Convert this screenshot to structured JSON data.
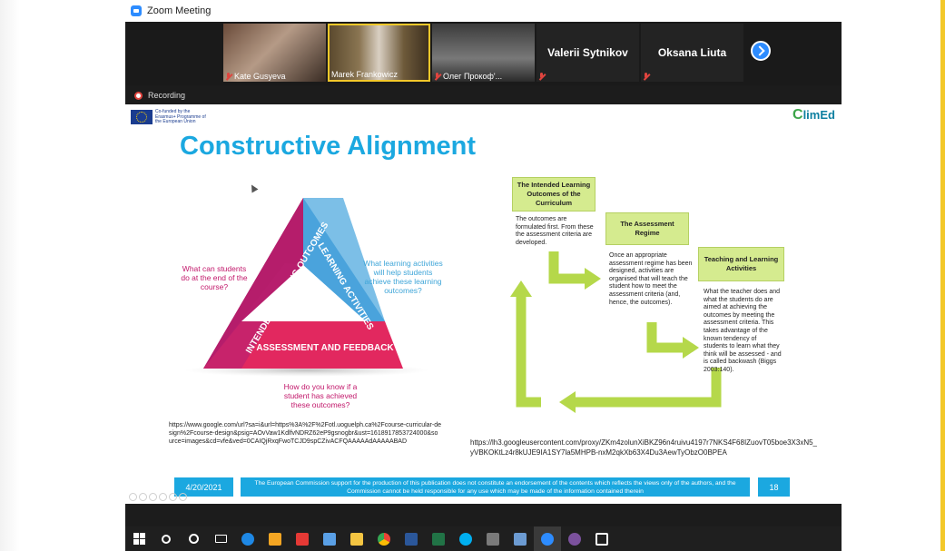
{
  "window": {
    "title": "Zoom Meeting"
  },
  "participants": [
    {
      "name": "Kate Gusyeva",
      "muted": true
    },
    {
      "name": "Marek Frankowicz",
      "muted": false
    },
    {
      "name": "Олег Прокоф'...",
      "muted": true
    },
    {
      "name": "Valerii Sytnikov",
      "muted": true
    },
    {
      "name": "Oksana Liuta",
      "muted": true
    }
  ],
  "recording_label": "Recording",
  "slide": {
    "logo_text": "Co-funded by the Erasmus+ Programme of the European Union",
    "brand": "ClimEd",
    "title": "Constructive Alignment",
    "triangle": {
      "left_side": "INTENDED LEARNING OUTCOMES",
      "right_side": "LEARNING ACTIVITIES",
      "bottom_side": "ASSESSMENT AND FEEDBACK"
    },
    "question_outcomes": "What can students do at the end of the course?",
    "question_activities": "What learning activities will help students achieve these learning outcomes?",
    "question_assessment": "How do you know if a student has achieved these outcomes?",
    "link_left": "https://www.google.com/url?sa=i&url=https%3A%2F%2Fotl.uoguelph.ca%2Fcourse-curricular-design%2Fcourse-design&psig=AOvVaw1KdlfvNDRZ62eP9gsnogbr&ust=1618917853724000&source=images&cd=vfe&ved=0CAIQjRxqFwoTCJD9spCZivACFQAAAAAdAAAAABAD",
    "link_right": "https://lh3.googleusercontent.com/proxy/ZKm4zolunXiBKZ96n4ruivu4197r7NKS4F68IZuovT05boe3X3xN5_yVBKOKtLz4r8kUJE9IA1SY7la5MHPB-nxM2qkXb63X4Du3AewTyObzO0BPEA",
    "flow": {
      "box1_title": "The Intended Learning Outcomes of the Curriculum",
      "box1_text": "The outcomes are formulated first. From these the assessment criteria are developed.",
      "box2_title": "The Assessment Regime",
      "box2_text": "Once an appropriate assessment regime has been designed, activities are organised that will teach the student how to meet the assessment criteria (and, hence, the outcomes).",
      "box3_title": "Teaching and Learning Activities",
      "box3_text": "What the teacher does and what the students do are aimed at achieving the outcomes by meeting the assessment criteria. This takes advantage of the known tendency of students to learn what they think will be assessed - and is called backwash (Biggs 2003:140)."
    },
    "footer": {
      "date": "4/20/2021",
      "disclaimer": "The European Commission support for the production of this publication does not constitute an endorsement of the contents which reflects the views only of the authors, and the Commission cannot be held responsible for any use which may be made of the information contained therein",
      "page": "18"
    }
  },
  "taskbar": [
    {
      "icon": "windows-start-icon",
      "color": "#ffffff"
    },
    {
      "icon": "search-icon",
      "color": "#ffffff"
    },
    {
      "icon": "cortana-icon",
      "color": "#ffffff"
    },
    {
      "icon": "task-view-icon",
      "color": "#ffffff"
    },
    {
      "icon": "edge-icon",
      "color": "#1e88e5"
    },
    {
      "icon": "store-icon",
      "color": "#f5a623"
    },
    {
      "icon": "gift-icon",
      "color": "#e53935"
    },
    {
      "icon": "mail-icon",
      "color": "#5aa0e6"
    },
    {
      "icon": "file-explorer-icon",
      "color": "#f4c542"
    },
    {
      "icon": "chrome-icon",
      "color": "#43a047"
    },
    {
      "icon": "word-icon",
      "color": "#2b579a"
    },
    {
      "icon": "excel-icon",
      "color": "#217346"
    },
    {
      "icon": "skype-icon",
      "color": "#00aff0"
    },
    {
      "icon": "save-icon",
      "color": "#7a7a7a"
    },
    {
      "icon": "pencil-icon",
      "color": "#6c9bd2"
    },
    {
      "icon": "zoom-icon",
      "color": "#2d8cff"
    },
    {
      "icon": "viber-icon",
      "color": "#7b519d"
    },
    {
      "icon": "acrobat-icon",
      "color": "#ffffff"
    }
  ]
}
